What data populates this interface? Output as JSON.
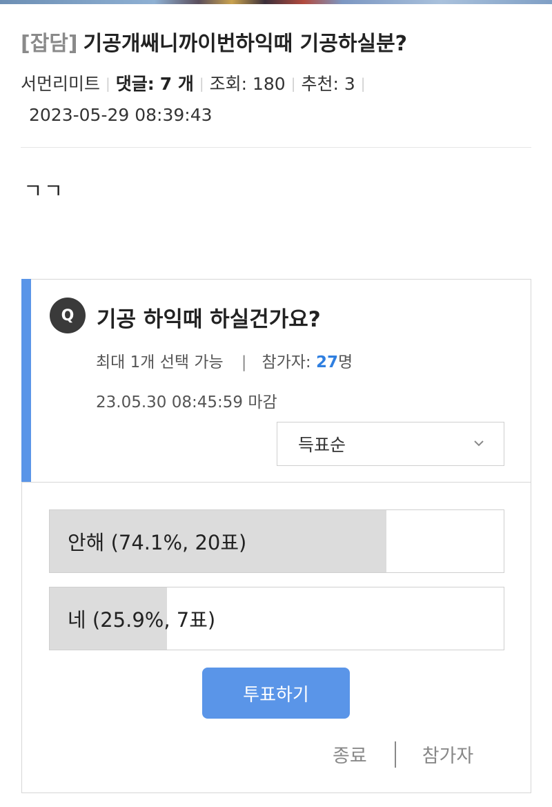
{
  "post": {
    "category": "[잡담]",
    "title": "기공개쌔니까이번하익때 기공하실분?",
    "author": "서먼리미트",
    "comments_label": "댓글:",
    "comments_count": "7 개",
    "views_label": "조회:",
    "views": "180",
    "recommend_label": "추천:",
    "recommend": "3",
    "date": "2023-05-29 08:39:43",
    "body": "ㄱㄱ"
  },
  "poll": {
    "q_badge": "Q",
    "question": "기공 하익때 하실건가요?",
    "max_select": "최대 1개 선택 가능",
    "participants_label": "참가자:",
    "participants_count": "27",
    "participants_unit": "명",
    "deadline": "23.05.30 08:45:59 마감",
    "sort_selected": "득표순",
    "options": [
      {
        "label": "안해 (74.1%, 20표)",
        "percent": 74.1
      },
      {
        "label": "네 (25.9%, 7표)",
        "percent": 25.9
      }
    ],
    "vote_button": "투표하기",
    "end_link": "종료",
    "participants_link": "참가자"
  },
  "colors": {
    "accent": "#5a95e8",
    "count_blue": "#2f7fe0",
    "option_fill": "#dcdcdc"
  }
}
